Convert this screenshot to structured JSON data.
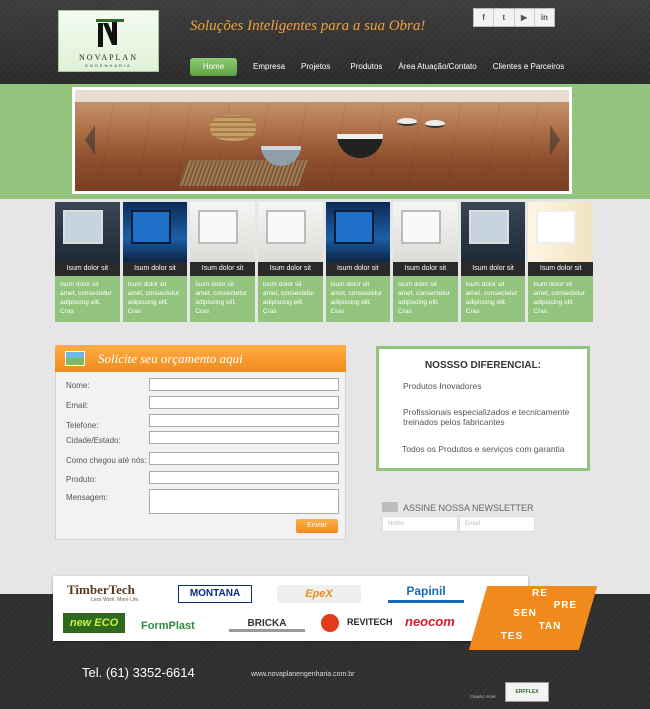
{
  "header": {
    "logo_brand": "NOVAPLAN",
    "logo_sub": "ENGENHARIA",
    "tagline": "Soluções Inteligentes para a sua Obra!",
    "social": [
      {
        "icon": "facebook-icon",
        "glyph": "f"
      },
      {
        "icon": "twitter-icon",
        "glyph": "t"
      },
      {
        "icon": "youtube-icon",
        "glyph": "▶"
      },
      {
        "icon": "linkedin-icon",
        "glyph": "in"
      }
    ],
    "nav": [
      "Home",
      "Empresa",
      "Projetos",
      "Produtos",
      "Área Atuação/Contato",
      "Clientes e Parceiros"
    ]
  },
  "thumbs": [
    {
      "caption": "Isum dolor sit",
      "text": "Isum dolor sit amet, consectetur adipiscing elit. Cras",
      "style": "dark"
    },
    {
      "caption": "Isum dolor sit",
      "text": "Isum dolor sit amet, consectetur adipiscing elit. Cras",
      "style": "blue"
    },
    {
      "caption": "Isum dolor sit",
      "text": "Isum dolor sit amet, consectetur adipiscing elit. Cras",
      "style": "white"
    },
    {
      "caption": "Isum dolor sit",
      "text": "Isum dolor sit amet, consectetur adipiscing elit. Cras",
      "style": "white"
    },
    {
      "caption": "Isum dolor sit",
      "text": "Isum dolor sit amet, consectetur adipiscing elit. Cras",
      "style": "blue"
    },
    {
      "caption": "Isum dolor sit",
      "text": "Isum dolor sit amet, consectetur adipiscing elit. Cras",
      "style": "white"
    },
    {
      "caption": "Isum dolor sit",
      "text": "Isum dolor sit amet, consectetur adipiscing elit. Cras",
      "style": "dark"
    },
    {
      "caption": "Isum dolor sit",
      "text": "Isum dolor sit amet, consectetur adipiscing elit. Cras",
      "style": "cream"
    }
  ],
  "form": {
    "title": "Solicite seu orçamento aqui",
    "fields": [
      "Nome:",
      "Email:",
      "Telefone:",
      "Cidade/Estado:",
      "Como chegou até nós:",
      "Produto:",
      "Mensagem:"
    ],
    "submit": "Enviar"
  },
  "diferencial": {
    "title": "NOSSSO DIFERENCIAL:",
    "items": [
      "Produtos Inovadores",
      "Profissionais especializados e  tecnicamente treinados pelos fabricantes",
      "Todos os Produtos e serviços com  garantia"
    ]
  },
  "newsletter": {
    "title": "ASSINE NOSSA NEWSLETTER",
    "name_placeholder": "Nome",
    "email_placeholder": "Email"
  },
  "partners": {
    "logos": [
      "TimberTech",
      "Less Work. More Life.",
      "MONTANA",
      "EpeX",
      "Papinil",
      "new ECO",
      "FormPlast",
      "BRICKA",
      "REVITECH",
      "neocom"
    ],
    "represents": [
      "RE",
      "PRE",
      "SEN",
      "TAN",
      "TES"
    ]
  },
  "footer": {
    "tel": "Tel. (61) 3352-6614",
    "site": "www.novaplanengenharia.com.br",
    "criado": "CRIADO POR:",
    "erp": "ERPFLEX"
  }
}
